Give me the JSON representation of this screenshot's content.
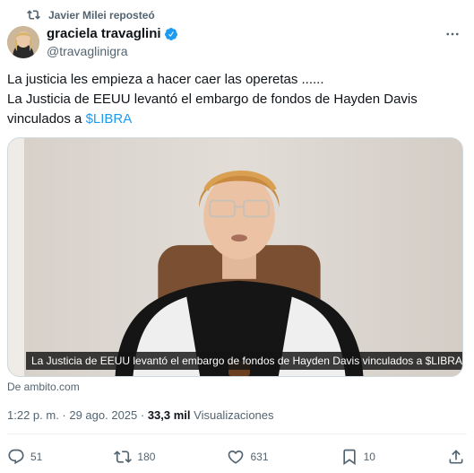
{
  "repost": {
    "text": "Javier Milei reposteó",
    "icon": "repost-icon"
  },
  "author": {
    "display_name": "graciela travaglini",
    "handle": "@travaglinigra",
    "verified_color": "#1d9bf0"
  },
  "tweet": {
    "line1": "La justicia les empieza a hacer caer las operetas ......",
    "line2": "La Justicia de EEUU levantó el embargo de fondos de Hayden Davis",
    "line3_prefix": "vinculados a ",
    "cashtag": "$LIBRA"
  },
  "media": {
    "caption": "La Justicia de EEUU levantó el embargo de fondos de Hayden Davis vinculados a $LIBRA"
  },
  "source": "De ambito.com",
  "meta": {
    "timestamp": "1:22 p. m. · 29 ago. 2025 · ",
    "views_count": "33,3 mil",
    "views_label": " Visualizaciones"
  },
  "actions": {
    "replies": "51",
    "reposts": "180",
    "likes": "631",
    "bookmarks": "10"
  },
  "colors": {
    "link": "#1d9bf0",
    "secondary": "#536471",
    "primary": "#0f1419"
  }
}
